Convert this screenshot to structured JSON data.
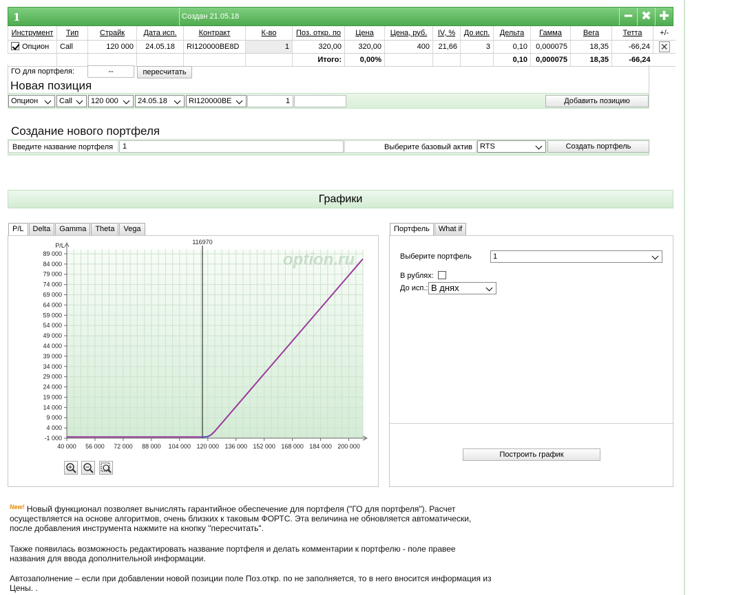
{
  "portfolio": {
    "number": "1",
    "created": "Создан 21.05.18",
    "icons": [
      "minimize-icon",
      "close-icon",
      "add-icon"
    ],
    "icon_glyphs": [
      "━",
      "✖",
      "✚"
    ],
    "columns": [
      "Инструмент",
      "Тип",
      "Страйк",
      "Дата исп.",
      "Контракт",
      "К-во",
      "Поз. откр. по",
      "Цена",
      "Цена, руб.",
      "IV, %",
      "До исп.",
      "Дельта",
      "Гамма",
      "Вега",
      "Тетта",
      "+/-"
    ],
    "row": {
      "checked": true,
      "instrument": "Опцион",
      "type": "Call",
      "strike": "120 000",
      "exp_date": "24.05.18",
      "contract": "RI120000BE8D",
      "qty": "1",
      "open_price": "320,00",
      "price": "320,00",
      "price_rub": "400",
      "iv": "21,66",
      "days": "3",
      "delta": "0,10",
      "gamma": "0,000075",
      "vega": "18,35",
      "theta": "-66,24",
      "remove": "✕"
    },
    "totals": {
      "label": "Итого:",
      "pct": "0,00%",
      "delta": "0,10",
      "gamma": "0,000075",
      "vega": "18,35",
      "theta": "-66,24"
    },
    "go_label": "ГО для портфеля:",
    "go_value": "--",
    "recalc_button": "пересчитать"
  },
  "new_position": {
    "title": "Новая позиция",
    "instrument": "Опцион",
    "type": "Call",
    "strike": "120 000",
    "date": "24.05.18",
    "contract": "RI120000BE",
    "qty": "1",
    "price": "",
    "add_button": "Добавить позицию"
  },
  "new_portfolio": {
    "title": "Создание нового портфеля",
    "name_label": "Введите название портфеля",
    "name_value": "1",
    "asset_label": "Выберите базовый актив",
    "asset_value": "RTS",
    "create_button": "Создать портфель"
  },
  "charts": {
    "title": "Графики",
    "tabs": [
      "P/L",
      "Delta",
      "Gamma",
      "Theta",
      "Vega"
    ],
    "active_tab": "P/L",
    "right_tabs": [
      "Портфель",
      "What if"
    ],
    "right_active_tab": "Портфель",
    "select_portfolio_label": "Выберите портфель",
    "select_portfolio_value": "1",
    "rubles_label": "В рублях:",
    "rubles_checked": false,
    "expiry_label": "До исп.:",
    "expiry_value": "В днях",
    "build_button": "Построить график"
  },
  "chart_data": {
    "type": "line",
    "ylabel": "P/L",
    "watermark": "option.ru",
    "marker_label": "116970",
    "marker_x": 116970,
    "xlim": [
      40000,
      208000
    ],
    "ylim": [
      -1000,
      91000
    ],
    "x_ticks": [
      40000,
      56000,
      72000,
      88000,
      104000,
      120000,
      136000,
      152000,
      168000,
      184000,
      200000
    ],
    "x_tick_labels": [
      "40 000",
      "56 000",
      "72 000",
      "88 000",
      "104 000",
      "120 000",
      "136 000",
      "152 000",
      "168 000",
      "184 000",
      "200 000"
    ],
    "y_ticks": [
      -1000,
      4000,
      9000,
      14000,
      19000,
      24000,
      29000,
      34000,
      39000,
      44000,
      49000,
      54000,
      59000,
      64000,
      69000,
      74000,
      79000,
      84000,
      89000
    ],
    "y_tick_labels": [
      "-1 000",
      "4 000",
      "9 000",
      "14 000",
      "19 000",
      "24 000",
      "29 000",
      "34 000",
      "39 000",
      "44 000",
      "49 000",
      "54 000",
      "59 000",
      "64 000",
      "69 000",
      "74 000",
      "79 000",
      "84 000",
      "89 000"
    ],
    "series": [
      {
        "color": "#9b3a9b",
        "x": [
          40000,
          104000,
          116970,
          120000,
          122000,
          124000,
          208000
        ],
        "values": [
          -400,
          -400,
          -400,
          -300,
          700,
          2400,
          86500
        ]
      },
      {
        "color": "#3a5fd0",
        "x": [
          116500,
          118000,
          119500,
          121000
        ],
        "values": [
          -400,
          -360,
          -200,
          200
        ]
      }
    ],
    "grid": true
  },
  "info": {
    "new_tag": "New!",
    "p1": "Новый функционал позволяет вычислять гарантийное обеспечение для портфеля (\"ГО для портфеля\"). Расчет осуществляется на основе алгоритмов, очень близких к таковым ФОРТС. Эта величина не обновляется автоматически, после добавления инструмента нажмите на кнопку \"пересчитать\".",
    "p2": "Также появилась возможность редактировать название портфеля и делать комментарии к портфелю - поле правее названия для ввода дополнительной информации.",
    "p3": "Автозаполнение – если при добавлении новой позиции поле Поз.откр. по не заполняется, то в него вносится информация из Цены. ."
  }
}
